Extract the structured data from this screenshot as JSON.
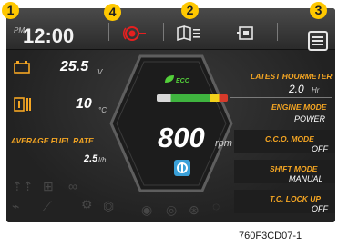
{
  "topbar": {
    "ampm": "PM",
    "time": "12:00"
  },
  "callouts": [
    "1",
    "2",
    "3",
    "4"
  ],
  "left": {
    "battery_value": "25.5",
    "battery_unit": "V",
    "temp_value": "10",
    "temp_unit": "°C",
    "fuel_label": "AVERAGE FUEL RATE",
    "fuel_value": "2.5",
    "fuel_unit": "l/h"
  },
  "center": {
    "eco_label": "ECO",
    "rpm_value": "800",
    "rpm_unit": "rpm"
  },
  "right": {
    "hourmeter_label": "LATEST HOURMETER",
    "hourmeter_value": "2.0",
    "hourmeter_unit": "Hr",
    "engine_mode_label": "ENGINE MODE",
    "engine_mode_value": "POWER",
    "cco_label": "C.C.O. MODE",
    "cco_value": "OFF",
    "shift_label": "SHIFT MODE",
    "shift_value": "MANUAL",
    "tc_label": "T.C. LOCK UP",
    "tc_value": "OFF"
  },
  "icons": {
    "warning": "alarm-icon",
    "book": "manual-icon",
    "camera": "camera-icon",
    "menu": "menu-icon"
  },
  "colors": {
    "accent": "#f5a623",
    "warning": "#e52020",
    "eco": "#53d03a",
    "callout": "#ffc800"
  },
  "footer_code": "760F3CD07-1"
}
